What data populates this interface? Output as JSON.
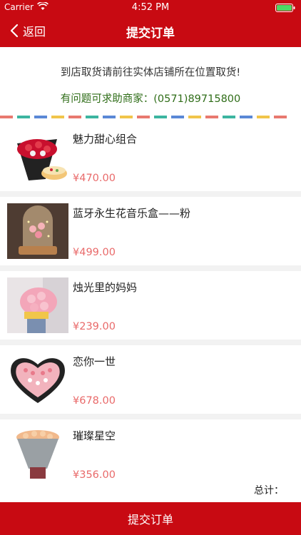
{
  "status_bar": {
    "carrier": "Carrier",
    "time": "4:52 PM"
  },
  "nav": {
    "back_label": "返回",
    "title": "提交订单"
  },
  "notice": "到店取货请前往实体店铺所在位置取货!",
  "help": "有问题可求助商家：(0571)89715800",
  "dash_colors": [
    "#e8796f",
    "#3cb5a0",
    "#5a88d6",
    "#f1c54a",
    "#e8796f",
    "#3cb5a0",
    "#5a88d6",
    "#f1c54a",
    "#e8796f",
    "#3cb5a0",
    "#5a88d6",
    "#f1c54a",
    "#e8796f",
    "#3cb5a0",
    "#5a88d6",
    "#f1c54a",
    "#e8796f"
  ],
  "items": [
    {
      "name": "魅力甜心组合",
      "price": "¥470.00",
      "image": "rose-bouquet-cake-image"
    },
    {
      "name": "蓝牙永生花音乐盒——粉",
      "price": "¥499.00",
      "image": "glass-dome-music-box-image"
    },
    {
      "name": "烛光里的妈妈",
      "price": "¥239.00",
      "image": "pink-bouquet-image"
    },
    {
      "name": "恋你一世",
      "price": "¥678.00",
      "image": "heart-box-roses-image"
    },
    {
      "name": "璀璨星空",
      "price": "¥356.00",
      "image": "champagne-roses-bouquet-image"
    }
  ],
  "total_label": "总计：",
  "submit_label": "提交订单",
  "colors": {
    "brand_red": "#c80a12",
    "price": "#e96a6a",
    "help_green": "#2f6d18"
  }
}
